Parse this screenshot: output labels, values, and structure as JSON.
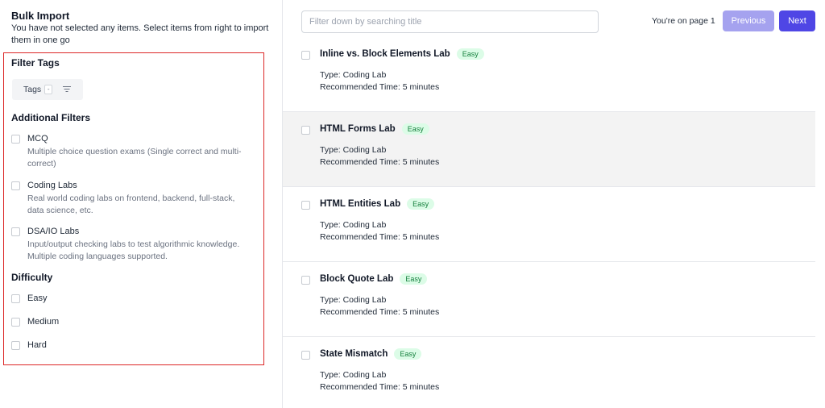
{
  "bulk_import": {
    "title": "Bulk Import",
    "subtitle": "You have not selected any items. Select items from right to import them in one go"
  },
  "filter_tags": {
    "heading": "Filter Tags",
    "tags_button_label": "Tags",
    "tags_count": "-"
  },
  "additional_filters": {
    "heading": "Additional Filters",
    "options": [
      {
        "label": "MCQ",
        "description": "Multiple choice question exams (Single correct and multi-correct)",
        "checked": false
      },
      {
        "label": "Coding Labs",
        "description": "Real world coding labs on frontend, backend, full-stack, data science, etc.",
        "checked": false
      },
      {
        "label": "DSA/IO Labs",
        "description": "Input/output checking labs to test algorithmic knowledge. Multiple coding languages supported.",
        "checked": false
      }
    ]
  },
  "difficulty": {
    "heading": "Difficulty",
    "options": [
      {
        "label": "Easy",
        "checked": false
      },
      {
        "label": "Medium",
        "checked": false
      },
      {
        "label": "Hard",
        "checked": false
      }
    ]
  },
  "search": {
    "placeholder": "Filter down by searching title",
    "value": ""
  },
  "pagination": {
    "page_info": "You're on page 1",
    "previous_label": "Previous",
    "next_label": "Next"
  },
  "items": [
    {
      "title": "Inline vs. Block Elements Lab",
      "badge": "Easy",
      "type": "Type: Coding Lab",
      "time": "Recommended Time: 5 minutes",
      "highlighted": false
    },
    {
      "title": "HTML Forms Lab",
      "badge": "Easy",
      "type": "Type: Coding Lab",
      "time": "Recommended Time: 5 minutes",
      "highlighted": true
    },
    {
      "title": "HTML Entities Lab",
      "badge": "Easy",
      "type": "Type: Coding Lab",
      "time": "Recommended Time: 5 minutes",
      "highlighted": false
    },
    {
      "title": "Block Quote Lab",
      "badge": "Easy",
      "type": "Type: Coding Lab",
      "time": "Recommended Time: 5 minutes",
      "highlighted": false
    },
    {
      "title": "State Mismatch",
      "badge": "Easy",
      "type": "Type: Coding Lab",
      "time": "Recommended Time: 5 minutes",
      "highlighted": false
    }
  ],
  "colors": {
    "accent": "#4f46e5",
    "accent_disabled": "#a5a2ef",
    "highlight_border": "#dc2626",
    "badge_bg": "#dcfce7",
    "badge_text": "#15803d"
  }
}
